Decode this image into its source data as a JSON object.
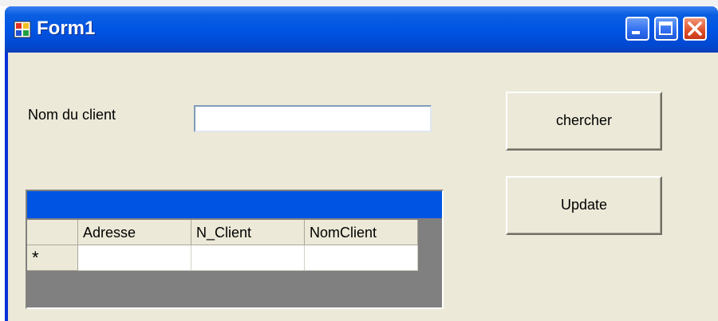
{
  "window": {
    "title": "Form1",
    "minimize_icon": "minimize-icon",
    "maximize_icon": "maximize-icon",
    "close_icon": "close-icon"
  },
  "form": {
    "client_label": "Nom du client",
    "client_input_value": "",
    "search_button": "chercher",
    "update_button": "Update"
  },
  "grid": {
    "columns": [
      "Adresse",
      "N_Client",
      "NomClient"
    ],
    "new_row_marker": "*"
  },
  "colors": {
    "titlebar": "#0055e5",
    "form_bg": "#ece9d8",
    "grid_caption": "#0054e3",
    "grid_bg": "#808080"
  }
}
